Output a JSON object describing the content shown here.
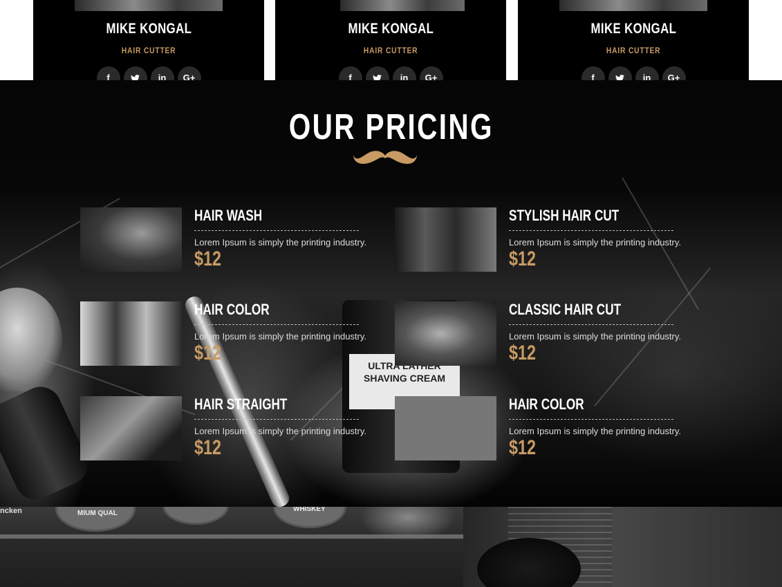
{
  "team": [
    {
      "name": "MIKE KONGAL",
      "role": "HAIR CUTTER"
    },
    {
      "name": "MIKE KONGAL",
      "role": "HAIR CUTTER"
    },
    {
      "name": "MIKE KONGAL",
      "role": "HAIR CUTTER"
    }
  ],
  "social_icons": {
    "facebook": "f",
    "twitter": "t",
    "linkedin": "in",
    "googleplus": "G+"
  },
  "pricing": {
    "title": "OUR PRICING",
    "items": [
      {
        "name": "HAIR WASH",
        "desc": "Lorem Ipsum is simply the printing industry.",
        "price": "$12"
      },
      {
        "name": "STYLISH HAIR CUT",
        "desc": "Lorem Ipsum is simply the printing industry.",
        "price": "$12"
      },
      {
        "name": "HAIR COLOR",
        "desc": "Lorem Ipsum is simply the printing industry.",
        "price": "$12"
      },
      {
        "name": "CLASSIC HAIR CUT",
        "desc": "Lorem Ipsum is simply the printing industry.",
        "price": "$12"
      },
      {
        "name": "HAIR STRAIGHT",
        "desc": "Lorem Ipsum is simply the printing industry.",
        "price": "$12"
      },
      {
        "name": "HAIR COLOR",
        "desc": "Lorem Ipsum is simply the printing industry.",
        "price": "$12"
      }
    ]
  },
  "background_text": {
    "jar_line1": "ULTRA LATHER",
    "jar_line2": "SHAVING CREAM",
    "whiskey": "WHISKEY",
    "premium": "MIUM QUAL"
  },
  "colors": {
    "accent": "#c89b64",
    "background": "#000000",
    "text": "#ffffff"
  }
}
